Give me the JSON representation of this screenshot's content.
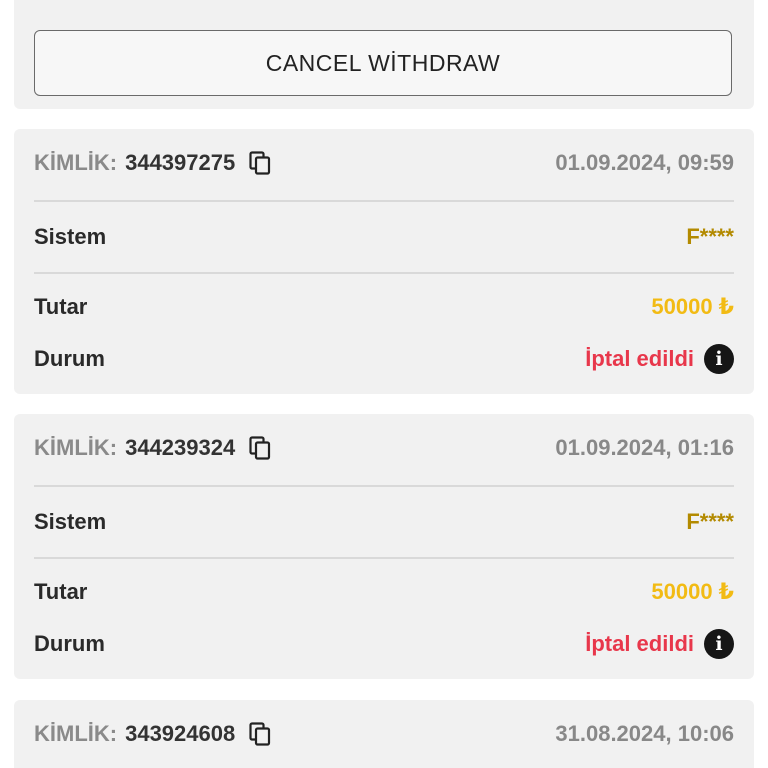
{
  "cancel_button": {
    "label": "CANCEL WİTHDRAW"
  },
  "labels": {
    "id": "KİMLİK:",
    "system": "Sistem",
    "amount": "Tutar",
    "status": "Durum"
  },
  "transactions": [
    {
      "id": "344397275",
      "datetime": "01.09.2024, 09:59",
      "system": "F****",
      "amount": "50000 ₺",
      "status": "İptal edildi"
    },
    {
      "id": "344239324",
      "datetime": "01.09.2024, 01:16",
      "system": "F****",
      "amount": "50000 ₺",
      "status": "İptal edildi"
    },
    {
      "id": "343924608",
      "datetime": "31.08.2024, 10:06"
    }
  ],
  "icons": {
    "copy": "copy-icon",
    "info": "info-icon"
  },
  "colors": {
    "status_cancelled": "#e8374b",
    "amount": "#f2bb14",
    "system": "#b38a00"
  }
}
